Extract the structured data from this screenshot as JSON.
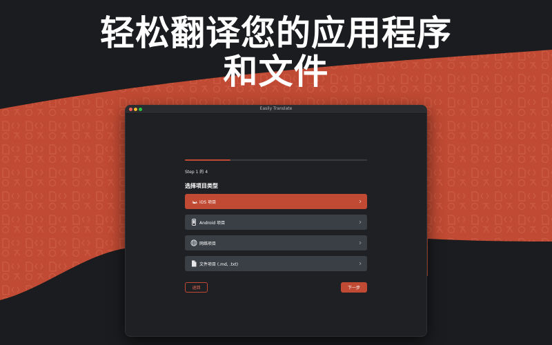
{
  "marketing": {
    "headline_line1": "轻松翻译您的应用程序",
    "headline_line2": "和文件"
  },
  "colors": {
    "accent": "#c04a33",
    "background": "#1b1c1f",
    "window": "#1f2023",
    "option": "#3a3f45"
  },
  "window": {
    "title": "Easily Translate"
  },
  "wizard": {
    "progress_fraction": 0.25,
    "step_label": "Step 1 的 4",
    "section_title": "选择项目类型",
    "options": [
      {
        "label": "iOS 项目",
        "icon": "swift-icon",
        "selected": true
      },
      {
        "label": "Android 项目",
        "icon": "phone-icon",
        "selected": false
      },
      {
        "label": "网络项目",
        "icon": "globe-icon",
        "selected": false
      },
      {
        "label": "文件项目 (.md, .txt)",
        "icon": "document-icon",
        "selected": false
      }
    ],
    "back_label": "退回",
    "next_label": "下一步"
  }
}
